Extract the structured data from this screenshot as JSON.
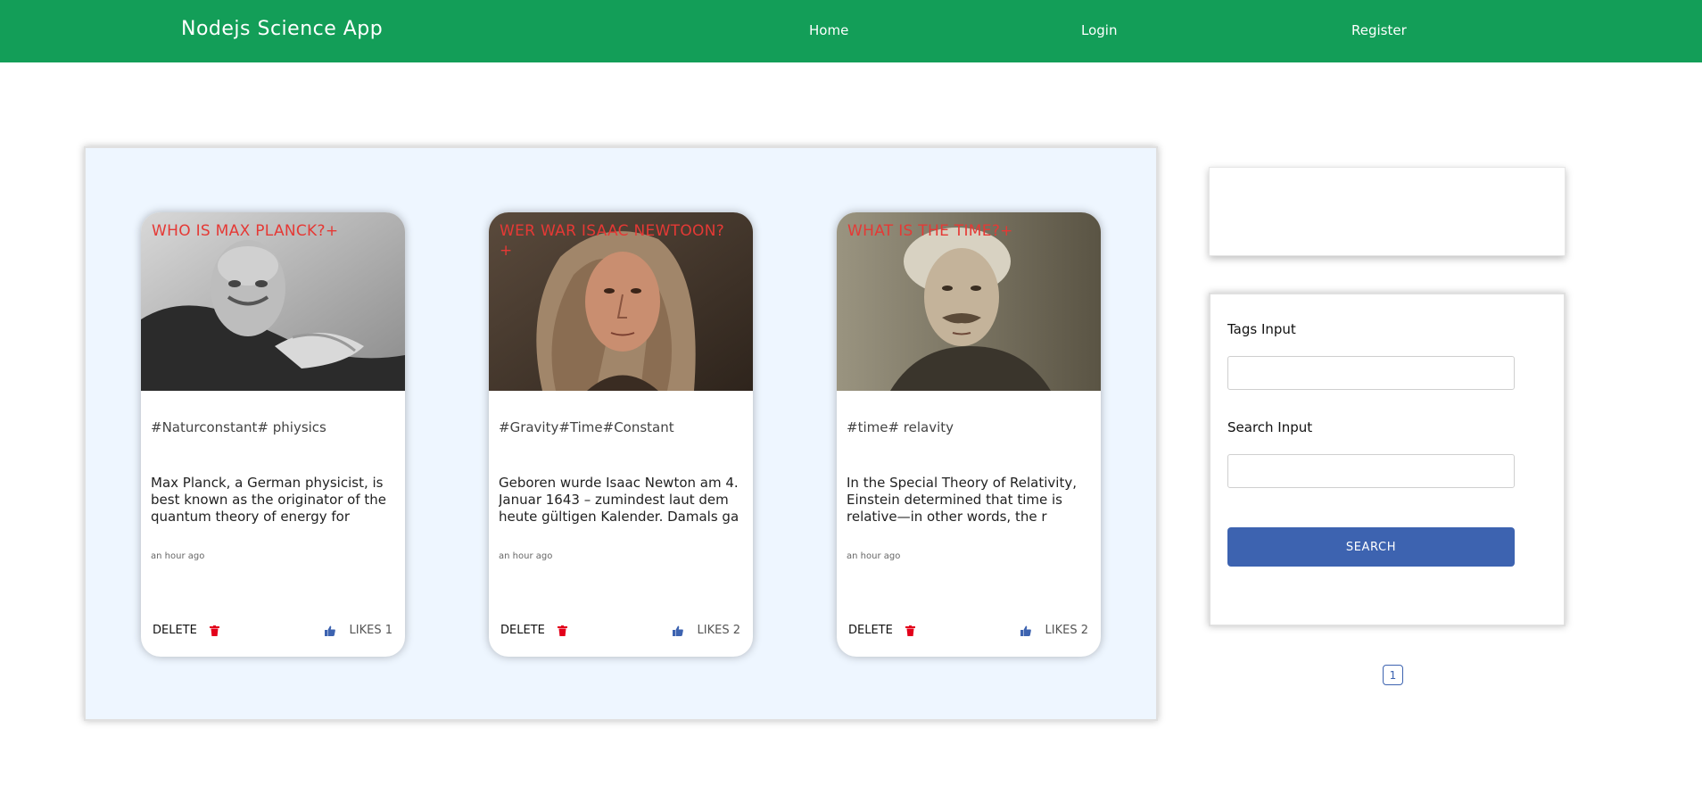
{
  "navbar": {
    "brand": "Nodejs Science App",
    "links": [
      "Home",
      "Login",
      "Register"
    ],
    "color": "#139e58"
  },
  "posts": [
    {
      "title": "WHO IS MAX PLANCK?+",
      "tags": "#Naturconstant# phiysics",
      "excerpt": "Max Planck, a German physicist, is best known as the originator of the quantum theory of energy for",
      "time": "an hour ago",
      "delete_label": "DELETE",
      "likes_label": "LIKES 1",
      "likes": 1,
      "image": "portrait-max-planck"
    },
    {
      "title": "WER WAR ISAAC NEWTOON?+",
      "tags": "#Gravity#Time#Constant",
      "excerpt": "Geboren wurde Isaac Newton am 4. Januar 1643 – zumindest laut dem heute gültigen Kalender. Damals ga",
      "time": "an hour ago",
      "delete_label": "DELETE",
      "likes_label": "LIKES 2",
      "likes": 2,
      "image": "portrait-isaac-newton"
    },
    {
      "title": "WHAT IS THE TIME?+",
      "tags": "#time# relavity",
      "excerpt": "In the Special Theory of Relativity, Einstein determined that time is relative—in other words, the r",
      "time": "an hour ago",
      "delete_label": "DELETE",
      "likes_label": "LIKES 2",
      "likes": 2,
      "image": "portrait-albert-einstein"
    }
  ],
  "sidebar": {
    "tags_label": "Tags Input",
    "tags_value": "",
    "search_label": "Search Input",
    "search_value": "",
    "search_button": "SEARCH",
    "button_color": "#3d63b0"
  },
  "pagination": {
    "current": "1"
  },
  "colors": {
    "panel_bg": "#eef6ff",
    "title_red": "#e53935",
    "delete_icon": "#e3001b",
    "like_icon": "#3d63b0"
  }
}
